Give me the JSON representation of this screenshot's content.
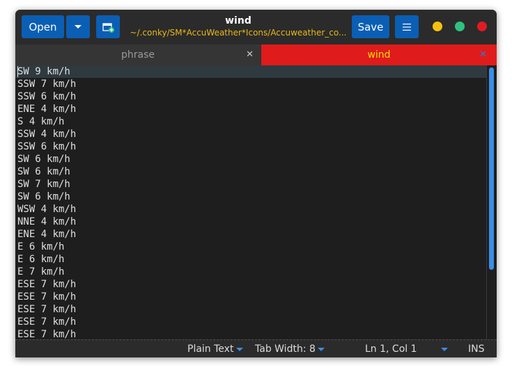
{
  "window": {
    "title": "wind",
    "subtitle": "~/.conky/SM*AccuWeather*Icons/Accuweather_co..."
  },
  "toolbar": {
    "open_label": "Open",
    "save_label": "Save"
  },
  "tabs": [
    {
      "label": "phrase",
      "active": false
    },
    {
      "label": "wind",
      "active": true
    }
  ],
  "editor": {
    "lines": [
      "SW 9 km/h",
      "SSW 7 km/h",
      "SSW 6 km/h",
      "ENE 4 km/h",
      "S 4 km/h",
      "SSW 4 km/h",
      "SSW 6 km/h",
      "SW 6 km/h",
      "SW 6 km/h",
      "SW 7 km/h",
      "SW 6 km/h",
      "WSW 4 km/h",
      "NNE 4 km/h",
      "ENE 4 km/h",
      "E 6 km/h",
      "E 6 km/h",
      "E 7 km/h",
      "ESE 7 km/h",
      "ESE 7 km/h",
      "ESE 7 km/h",
      "ESE 7 km/h",
      "ESE 7 km/h"
    ]
  },
  "statusbar": {
    "language": "Plain Text",
    "tab_width": "Tab Width: 8",
    "position": "Ln 1, Col 1",
    "mode": "INS"
  },
  "colors": {
    "accent": "#0a5fb4",
    "active_tab": "#e01b1b",
    "active_tab_text": "#f6e000",
    "subtitle_text": "#e8b818"
  },
  "icons": {
    "new_document": "document-new-icon",
    "menu": "hamburger-menu-icon",
    "dropdown": "chevron-down-icon"
  }
}
